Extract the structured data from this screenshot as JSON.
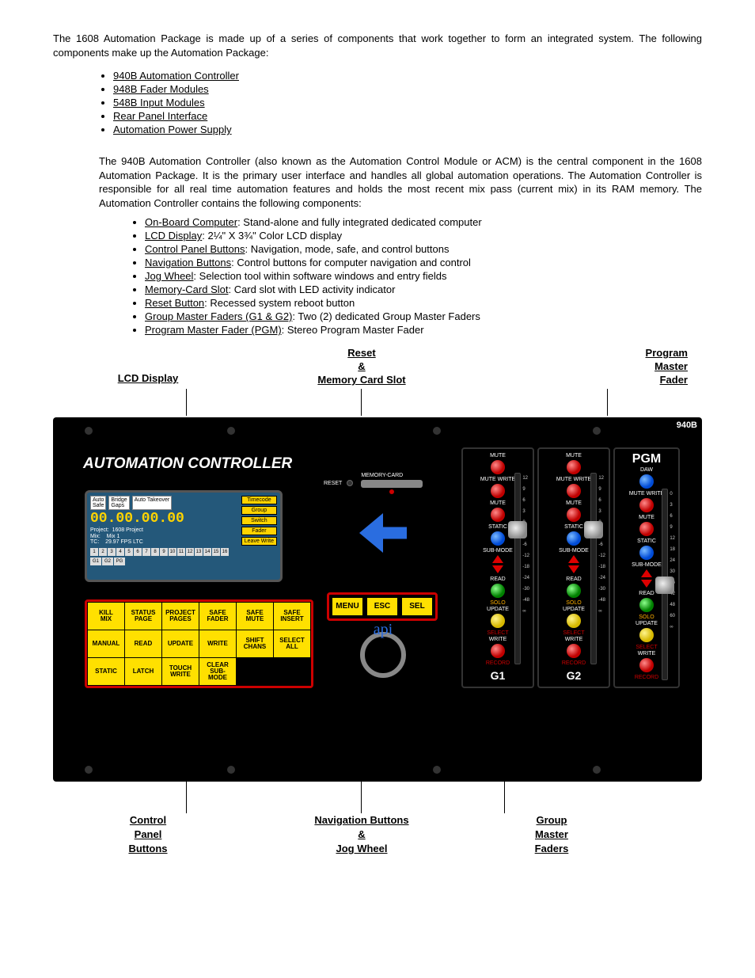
{
  "intro": "The 1608 Automation Package is made up of a series of components that work together to form an integrated system. The following components make up the Automation Package:",
  "components": [
    "940B Automation Controller",
    "948B Fader Modules",
    "548B Input Modules",
    "Rear Panel Interface",
    "Automation Power Supply"
  ],
  "section_intro": "The 940B Automation Controller (also known as the Automation Control Module or ACM) is the central component in the 1608 Automation Package. It is the primary user interface and handles all global automation operations. The Automation Controller is responsible for all real time automation features and holds the most recent mix pass (current mix) in its RAM memory. The Automation Controller contains the following components:",
  "sub": [
    {
      "u": "On-Board Computer",
      "t": ": Stand-alone and fully integrated dedicated computer"
    },
    {
      "u": "LCD Display",
      "t": ": 2¼\" X 3¾\" Color LCD display"
    },
    {
      "u": "Control Panel Buttons",
      "t": ": Navigation, mode, safe, and control buttons"
    },
    {
      "u": "Navigation Buttons",
      "t": ": Control buttons for computer navigation and control"
    },
    {
      "u": "Jog Wheel",
      "t": ": Selection tool within software windows and entry fields"
    },
    {
      "u": "Memory-Card Slot",
      "t": ": Card slot with LED activity indicator"
    },
    {
      "u": "Reset Button",
      "t": ": Recessed system reboot button"
    },
    {
      "u": "Group Master Faders (G1 & G2)",
      "t": ": Two (2) dedicated Group Master Faders"
    },
    {
      "u": "Program Master Fader (PGM)",
      "t": ": Stereo Program Master Fader"
    }
  ],
  "top_labels": {
    "lcd": "LCD Display",
    "reset": "Reset\n&\nMemory Card Slot",
    "pgm": "Program\nMaster\nFader"
  },
  "bottom_labels": {
    "cpb": "Control\nPanel\nButtons",
    "nav": "Navigation Buttons\n&\nJog Wheel",
    "gmf": "Group\nMaster\nFaders"
  },
  "panel": {
    "title": "AUTOMATION CONTROLLER",
    "model": "940B",
    "lcd": {
      "tabs": [
        "Auto\nSafe",
        "Bridge\nGaps",
        "Auto Takeover"
      ],
      "timecode": "00.00.00.00",
      "project_lbl": "Project:",
      "project": "1608 Project",
      "mix_lbl": "Mix:",
      "mix": "Mix 1",
      "tc_lbl": "TC:",
      "tc": "29.97 FPS LTC",
      "nums": [
        "1",
        "2",
        "3",
        "4",
        "5",
        "6",
        "7",
        "8",
        "9",
        "10",
        "11",
        "12",
        "13",
        "14",
        "15",
        "16"
      ],
      "grp": [
        "G1",
        "G2",
        "PG"
      ],
      "side": [
        "Timecode",
        "Group",
        "Switch",
        "Fader",
        "Leave Write"
      ]
    },
    "grid": [
      [
        "KILL MIX",
        "STATUS PAGE",
        "PROJECT PAGES",
        "SAFE FADER",
        "SAFE MUTE",
        "SAFE INSERT"
      ],
      [
        "MANUAL",
        "READ",
        "UPDATE",
        "WRITE",
        "SHIFT CHANS",
        "SELECT ALL"
      ],
      [
        "STATIC",
        "LATCH",
        "TOUCH WRITE",
        "CLEAR SUB-MODE",
        "",
        ""
      ]
    ],
    "center": {
      "reset": "RESET",
      "mc": "MEMORY-CARD",
      "api": "api",
      "menu": "MENU",
      "esc": "ESC",
      "sel": "SEL"
    },
    "fader_labels": {
      "mute": "MUTE",
      "mute_write": "MUTE WRITE",
      "static": "STATIC",
      "sub": "SUB-MODE",
      "read": "READ",
      "update": "UPDATE",
      "write": "WRITE",
      "solo": "SOLO",
      "select": "SELECT",
      "record": "RECORD",
      "g1": "G1",
      "g2": "G2",
      "pgm": "PGM",
      "daw": "DAW"
    },
    "scale_g": [
      "12",
      "9",
      "6",
      "3",
      "0",
      "-3",
      "-6",
      "-12",
      "-18",
      "-24",
      "-30",
      "-48",
      "∞"
    ],
    "scale_pgm": [
      "0",
      "3",
      "6",
      "9",
      "12",
      "18",
      "24",
      "30",
      "36",
      "42",
      "48",
      "60",
      "∞"
    ]
  }
}
